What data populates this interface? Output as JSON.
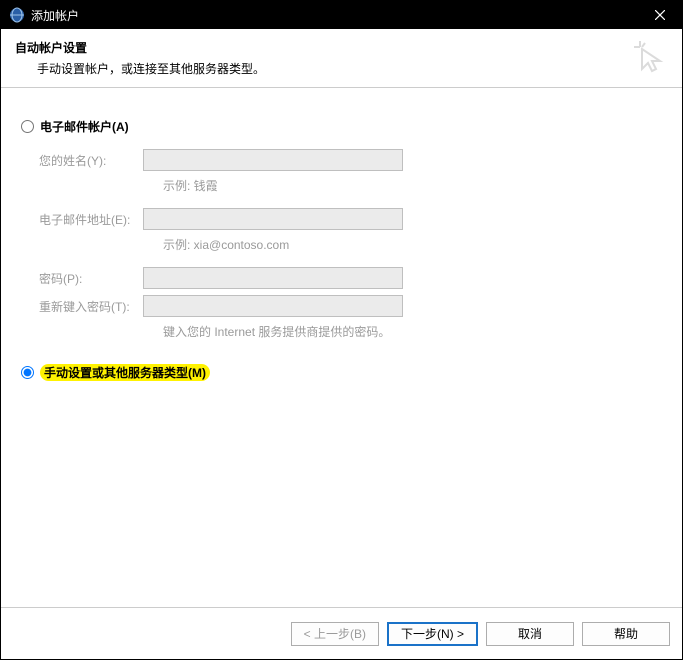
{
  "titlebar": {
    "title": "添加帐户"
  },
  "header": {
    "title": "自动帐户设置",
    "subtitle": "手动设置帐户，或连接至其他服务器类型。"
  },
  "options": {
    "email_label": "电子邮件帐户(A)",
    "manual_label": "手动设置或其他服务器类型(M)"
  },
  "form": {
    "name_label": "您的姓名(Y):",
    "name_hint": "示例: 钱霞",
    "email_label": "电子邮件地址(E):",
    "email_hint": "示例: xia@contoso.com",
    "password_label": "密码(P):",
    "retype_label": "重新键入密码(T):",
    "password_hint": "键入您的 Internet 服务提供商提供的密码。"
  },
  "footer": {
    "back": "< 上一步(B)",
    "next": "下一步(N) >",
    "cancel": "取消",
    "help": "帮助"
  }
}
